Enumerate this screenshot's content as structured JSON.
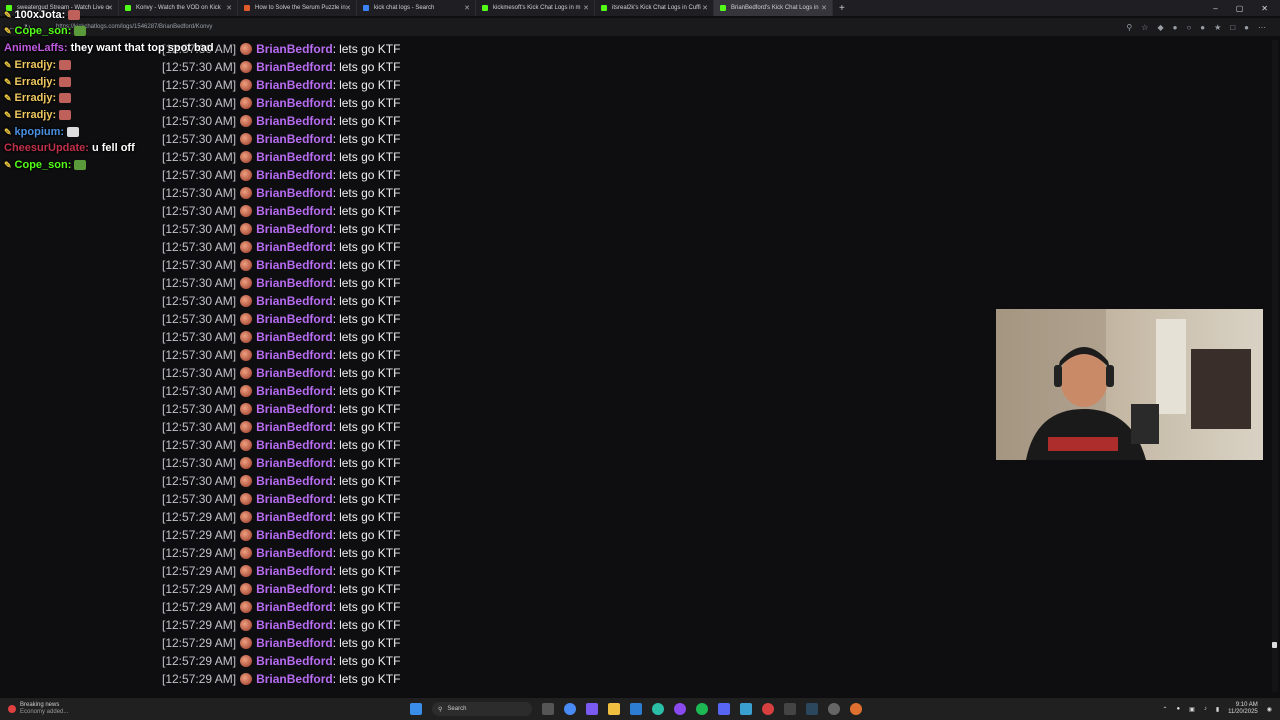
{
  "browser": {
    "tabs": [
      {
        "label": "sweatergud Stream - Watch Live o",
        "color": "#53fc18"
      },
      {
        "label": "Konvy - Watch the VOD on Kick",
        "color": "#53fc18"
      },
      {
        "label": "How to Solve the Serum Puzzle in",
        "color": "#e05a2a"
      },
      {
        "label": "kick chat logs - Search",
        "color": "#3b82f6"
      },
      {
        "label": "kickmesoft's Kick Chat Logs in m",
        "color": "#53fc18"
      },
      {
        "label": "itsreal2k's Kick Chat Logs in Cuffi",
        "color": "#53fc18"
      },
      {
        "label": "BrianBedford's Kick Chat Logs in",
        "color": "#53fc18"
      }
    ],
    "new_tab": "+",
    "url": "https://kickchatlogs.com/logs/1546287/BrianBedford/Konvy"
  },
  "overlay_chat": [
    {
      "user": "Cope_son:",
      "color": "#53fc18",
      "text": "",
      "emote": "#5a9a3a"
    },
    {
      "user": "AnimeLaffs:",
      "color": "#c05ae0",
      "text": "they want that top spot bad",
      "emote": ""
    },
    {
      "user": "Erradjy:",
      "color": "#f0c860",
      "text": "",
      "emote": "#c0605a"
    },
    {
      "user": "Erradjy:",
      "color": "#f0c860",
      "text": "",
      "emote": "#c0605a"
    },
    {
      "user": "Erradjy:",
      "color": "#f0c860",
      "text": "",
      "emote": "#c0605a"
    },
    {
      "user": "Erradjy:",
      "color": "#f0c860",
      "text": "",
      "emote": "#c0605a"
    },
    {
      "user": "kpopium:",
      "color": "#4a90e2",
      "text": "",
      "emote": "#dddddd"
    },
    {
      "user": "CheesurUpdate:",
      "color": "#c0304a",
      "text": "u fell off",
      "emote": ""
    },
    {
      "user": "Cope_son:",
      "color": "#53fc18",
      "text": "",
      "emote": "#5a9a3a"
    }
  ],
  "overlay_top": [
    {
      "user": "100xJota:",
      "color": "#ffffff"
    }
  ],
  "chat_log": {
    "user": "BrianBedford",
    "user_color": "#b76cf2",
    "message": "lets go KTF",
    "timestamps": [
      "[12:57:30 AM]",
      "[12:57:30 AM]",
      "[12:57:30 AM]",
      "[12:57:30 AM]",
      "[12:57:30 AM]",
      "[12:57:30 AM]",
      "[12:57:30 AM]",
      "[12:57:30 AM]",
      "[12:57:30 AM]",
      "[12:57:30 AM]",
      "[12:57:30 AM]",
      "[12:57:30 AM]",
      "[12:57:30 AM]",
      "[12:57:30 AM]",
      "[12:57:30 AM]",
      "[12:57:30 AM]",
      "[12:57:30 AM]",
      "[12:57:30 AM]",
      "[12:57:30 AM]",
      "[12:57:30 AM]",
      "[12:57:30 AM]",
      "[12:57:30 AM]",
      "[12:57:30 AM]",
      "[12:57:30 AM]",
      "[12:57:30 AM]",
      "[12:57:30 AM]",
      "[12:57:29 AM]",
      "[12:57:29 AM]",
      "[12:57:29 AM]",
      "[12:57:29 AM]",
      "[12:57:29 AM]",
      "[12:57:29 AM]",
      "[12:57:29 AM]",
      "[12:57:29 AM]",
      "[12:57:29 AM]",
      "[12:57:29 AM]"
    ]
  },
  "taskbar": {
    "news_title": "Breaking news",
    "news_sub": "Economy added...",
    "search_placeholder": "Search",
    "time": "9:10 AM",
    "date": "11/20/2025"
  }
}
